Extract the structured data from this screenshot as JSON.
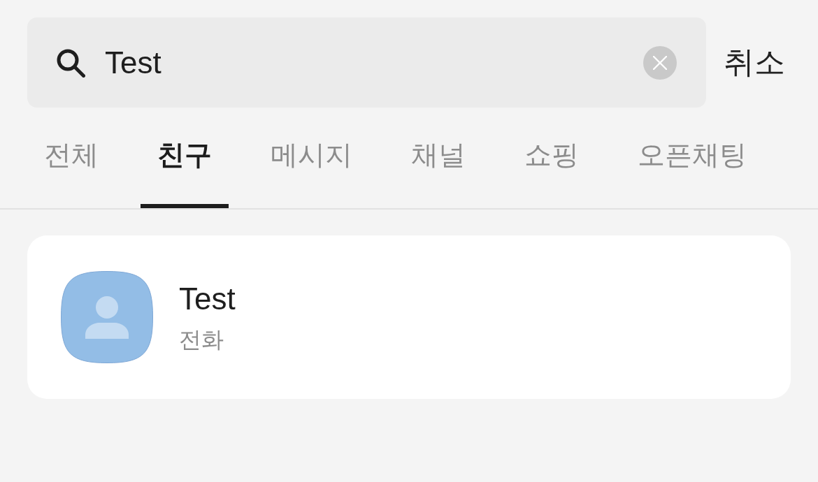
{
  "search": {
    "value": "Test"
  },
  "cancel_button": "취소",
  "tabs": [
    {
      "label": "전체",
      "selected": false
    },
    {
      "label": "친구",
      "selected": true
    },
    {
      "label": "메시지",
      "selected": false
    },
    {
      "label": "채널",
      "selected": false
    },
    {
      "label": "쇼핑",
      "selected": false
    },
    {
      "label": "오픈채팅",
      "selected": false
    }
  ],
  "results": [
    {
      "name": "Test",
      "subtitle": "전화"
    }
  ]
}
